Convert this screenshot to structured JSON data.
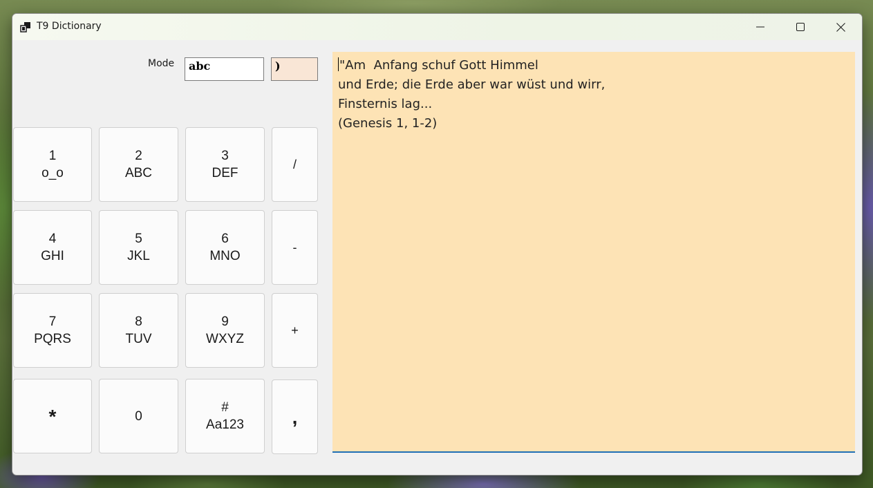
{
  "window": {
    "title": "T9 Dictionary"
  },
  "mode": {
    "label": "Mode",
    "value": "abc",
    "preview": ")"
  },
  "keypad": {
    "rows": [
      [
        {
          "digit": "1",
          "letters": "o_o"
        },
        {
          "digit": "2",
          "letters": "ABC"
        },
        {
          "digit": "3",
          "letters": "DEF"
        },
        {
          "digit": "/",
          "letters": ""
        }
      ],
      [
        {
          "digit": "4",
          "letters": "GHI"
        },
        {
          "digit": "5",
          "letters": "JKL"
        },
        {
          "digit": "6",
          "letters": "MNO"
        },
        {
          "digit": "-",
          "letters": ""
        }
      ],
      [
        {
          "digit": "7",
          "letters": "PQRS"
        },
        {
          "digit": "8",
          "letters": "TUV"
        },
        {
          "digit": "9",
          "letters": "WXYZ"
        },
        {
          "digit": "+",
          "letters": ""
        }
      ],
      [
        {
          "digit": "*",
          "letters": ""
        },
        {
          "digit": "0",
          "letters": ""
        },
        {
          "digit": "#",
          "letters": "Aa123"
        },
        {
          "digit": ",",
          "letters": ""
        }
      ]
    ]
  },
  "editor": {
    "lines": [
      "\"Am  Anfang schuf Gott Himmel",
      "und Erde; die Erde aber war wüst und wirr,",
      "Finsternis lag...",
      "(Genesis 1, 1-2)"
    ],
    "background": "#fde3b5"
  }
}
